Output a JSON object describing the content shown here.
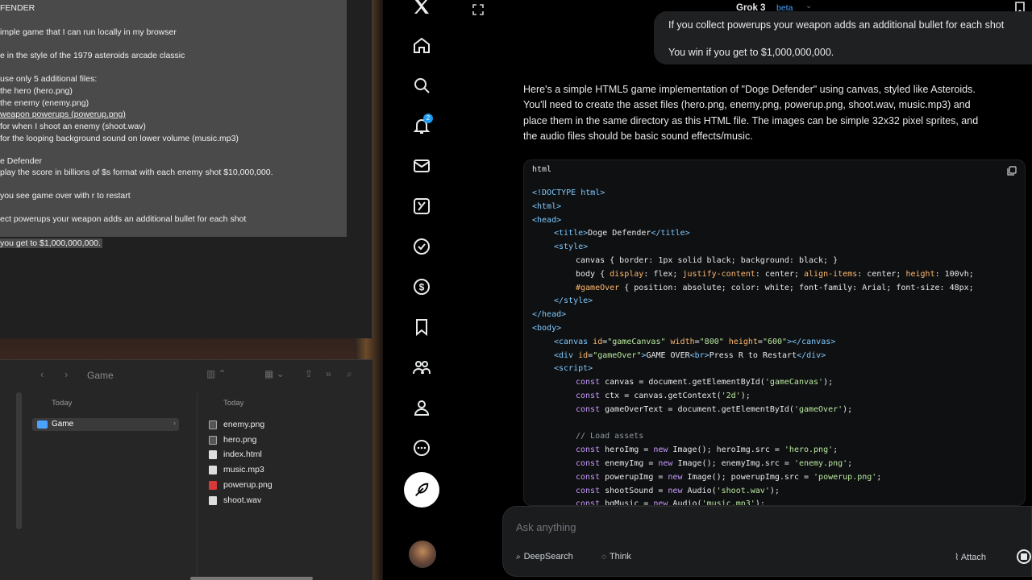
{
  "editor": {
    "lines": [
      "FENDER",
      "imple game that I can run locally in my browser",
      "e in the style of the 1979 asteroids arcade classic",
      "use only 5 additional files:",
      "the hero (hero.png)",
      "the enemy (enemy.png)",
      "weapon powerups (powerup.png)",
      "for when I shoot an enemy (shoot.wav)",
      "for the looping background sound on lower volume (music.mp3)",
      "e Defender",
      "play the score in billions of $s format with each enemy shot $10,000,000.",
      "you see game over with r to restart",
      "ect powerups your weapon adds an additional bullet for each shot",
      "you get to $1,000,000,000."
    ]
  },
  "finder": {
    "title": "Game",
    "col1_header": "Today",
    "col2_header": "Today",
    "folder": "Game",
    "files": [
      {
        "name": "enemy.png",
        "icon": "image-file-icon"
      },
      {
        "name": "hero.png",
        "icon": "image-file-icon"
      },
      {
        "name": "index.html",
        "icon": "html-file-icon"
      },
      {
        "name": "music.mp3",
        "icon": "audio-file-icon"
      },
      {
        "name": "powerup.png",
        "icon": "image-file-icon",
        "color": "#d63a3a"
      },
      {
        "name": "shoot.wav",
        "icon": "audio-file-icon"
      }
    ]
  },
  "sidebar": {
    "notification_count": "2",
    "items": [
      "x-logo-icon",
      "home-icon",
      "search-icon",
      "notifications-icon",
      "messages-icon",
      "grok-icon",
      "lists-icon",
      "money-icon",
      "bookmarks-icon",
      "communities-icon",
      "profile-icon",
      "more-icon"
    ]
  },
  "chat": {
    "model": "Grok 3",
    "model_badge": "beta",
    "user_lines": [
      "If you collect powerups your weapon adds an additional bullet for each shot",
      "You win if you get to $1,000,000,000."
    ],
    "answer_lines": [
      "Here's a simple HTML5 game implementation of \"Doge Defender\" using canvas, styled like Asteroids.",
      "You'll need to create the asset files (hero.png, enemy.png, powerup.png, shoot.wav, music.mp3) and",
      "place them in the same directory as this HTML file. The images can be simple 32x32 pixel sprites, and",
      "the audio files should be basic sound effects/music."
    ],
    "code_lang": "html",
    "code_lines": [
      {
        "indent": 0,
        "parts": [
          [
            "tag",
            "<!DOCTYPE html>"
          ]
        ]
      },
      {
        "indent": 0,
        "parts": [
          [
            "tag",
            "<html>"
          ]
        ]
      },
      {
        "indent": 0,
        "parts": [
          [
            "tag",
            "<head>"
          ]
        ]
      },
      {
        "indent": 1,
        "parts": [
          [
            "tag",
            "<title>"
          ],
          [
            "plain",
            "Doge Defender"
          ],
          [
            "tag",
            "</title>"
          ]
        ]
      },
      {
        "indent": 1,
        "parts": [
          [
            "tag",
            "<style>"
          ]
        ]
      },
      {
        "indent": 2,
        "parts": [
          [
            "plain",
            "canvas { border: 1px solid black; background: black; }"
          ]
        ]
      },
      {
        "indent": 2,
        "parts": [
          [
            "plain",
            "body { "
          ],
          [
            "attr",
            "display"
          ],
          [
            "plain",
            ": flex; "
          ],
          [
            "attr",
            "justify-content"
          ],
          [
            "plain",
            ": center; "
          ],
          [
            "attr",
            "align-items"
          ],
          [
            "plain",
            ": center; "
          ],
          [
            "attr",
            "height"
          ],
          [
            "plain",
            ": 100vh;"
          ]
        ]
      },
      {
        "indent": 2,
        "parts": [
          [
            "attr",
            "#gameOver"
          ],
          [
            "plain",
            " { position: absolute; color: white; font-family: Arial; font-size: 48px;"
          ]
        ]
      },
      {
        "indent": 1,
        "parts": [
          [
            "tag",
            "</style>"
          ]
        ]
      },
      {
        "indent": 0,
        "parts": [
          [
            "tag",
            "</head>"
          ]
        ]
      },
      {
        "indent": 0,
        "parts": [
          [
            "tag",
            "<body>"
          ]
        ]
      },
      {
        "indent": 1,
        "parts": [
          [
            "tag",
            "<canvas "
          ],
          [
            "attr",
            "id"
          ],
          [
            "plain",
            "="
          ],
          [
            "str",
            "\"gameCanvas\""
          ],
          [
            "attr",
            " width"
          ],
          [
            "plain",
            "="
          ],
          [
            "str",
            "\"800\""
          ],
          [
            "attr",
            " height"
          ],
          [
            "plain",
            "="
          ],
          [
            "str",
            "\"600\""
          ],
          [
            "tag",
            "></canvas>"
          ]
        ]
      },
      {
        "indent": 1,
        "parts": [
          [
            "tag",
            "<div "
          ],
          [
            "attr",
            "id"
          ],
          [
            "plain",
            "="
          ],
          [
            "str",
            "\"gameOver\""
          ],
          [
            "tag",
            ">"
          ],
          [
            "plain",
            "GAME OVER"
          ],
          [
            "tag",
            "<br>"
          ],
          [
            "plain",
            "Press R to Restart"
          ],
          [
            "tag",
            "</div>"
          ]
        ]
      },
      {
        "indent": 1,
        "parts": [
          [
            "tag",
            "<script>"
          ]
        ]
      },
      {
        "indent": 2,
        "parts": [
          [
            "kw",
            "const"
          ],
          [
            "plain",
            " canvas = document.getElementById("
          ],
          [
            "str",
            "'gameCanvas'"
          ],
          [
            "plain",
            ");"
          ]
        ]
      },
      {
        "indent": 2,
        "parts": [
          [
            "kw",
            "const"
          ],
          [
            "plain",
            " ctx = canvas.getContext("
          ],
          [
            "str",
            "'2d'"
          ],
          [
            "plain",
            ");"
          ]
        ]
      },
      {
        "indent": 2,
        "parts": [
          [
            "kw",
            "const"
          ],
          [
            "plain",
            " gameOverText = document.getElementById("
          ],
          [
            "str",
            "'gameOver'"
          ],
          [
            "plain",
            ");"
          ]
        ]
      },
      {
        "indent": 0,
        "parts": [
          [
            "plain",
            ""
          ]
        ]
      },
      {
        "indent": 2,
        "parts": [
          [
            "cm",
            "// Load assets"
          ]
        ]
      },
      {
        "indent": 2,
        "parts": [
          [
            "kw",
            "const"
          ],
          [
            "plain",
            " heroImg = "
          ],
          [
            "kw",
            "new"
          ],
          [
            "plain",
            " Image(); heroImg.src = "
          ],
          [
            "str",
            "'hero.png'"
          ],
          [
            "plain",
            ";"
          ]
        ]
      },
      {
        "indent": 2,
        "parts": [
          [
            "kw",
            "const"
          ],
          [
            "plain",
            " enemyImg = "
          ],
          [
            "kw",
            "new"
          ],
          [
            "plain",
            " Image(); enemyImg.src = "
          ],
          [
            "str",
            "'enemy.png'"
          ],
          [
            "plain",
            ";"
          ]
        ]
      },
      {
        "indent": 2,
        "parts": [
          [
            "kw",
            "const"
          ],
          [
            "plain",
            " powerupImg = "
          ],
          [
            "kw",
            "new"
          ],
          [
            "plain",
            " Image(); powerupImg.src = "
          ],
          [
            "str",
            "'powerup.png'"
          ],
          [
            "plain",
            ";"
          ]
        ]
      },
      {
        "indent": 2,
        "parts": [
          [
            "kw",
            "const"
          ],
          [
            "plain",
            " shootSound = "
          ],
          [
            "kw",
            "new"
          ],
          [
            "plain",
            " Audio("
          ],
          [
            "str",
            "'shoot.wav'"
          ],
          [
            "plain",
            ");"
          ]
        ]
      },
      {
        "indent": 2,
        "parts": [
          [
            "kw",
            "const"
          ],
          [
            "plain",
            " bgMusic = "
          ],
          [
            "kw",
            "new"
          ],
          [
            "plain",
            " Audio("
          ],
          [
            "str",
            "'music.mp3'"
          ],
          [
            "plain",
            ");"
          ]
        ]
      }
    ],
    "composer": {
      "placeholder": "Ask anything",
      "deepsearch_label": "DeepSearch",
      "think_label": "Think",
      "attach_label": "Attach"
    }
  }
}
